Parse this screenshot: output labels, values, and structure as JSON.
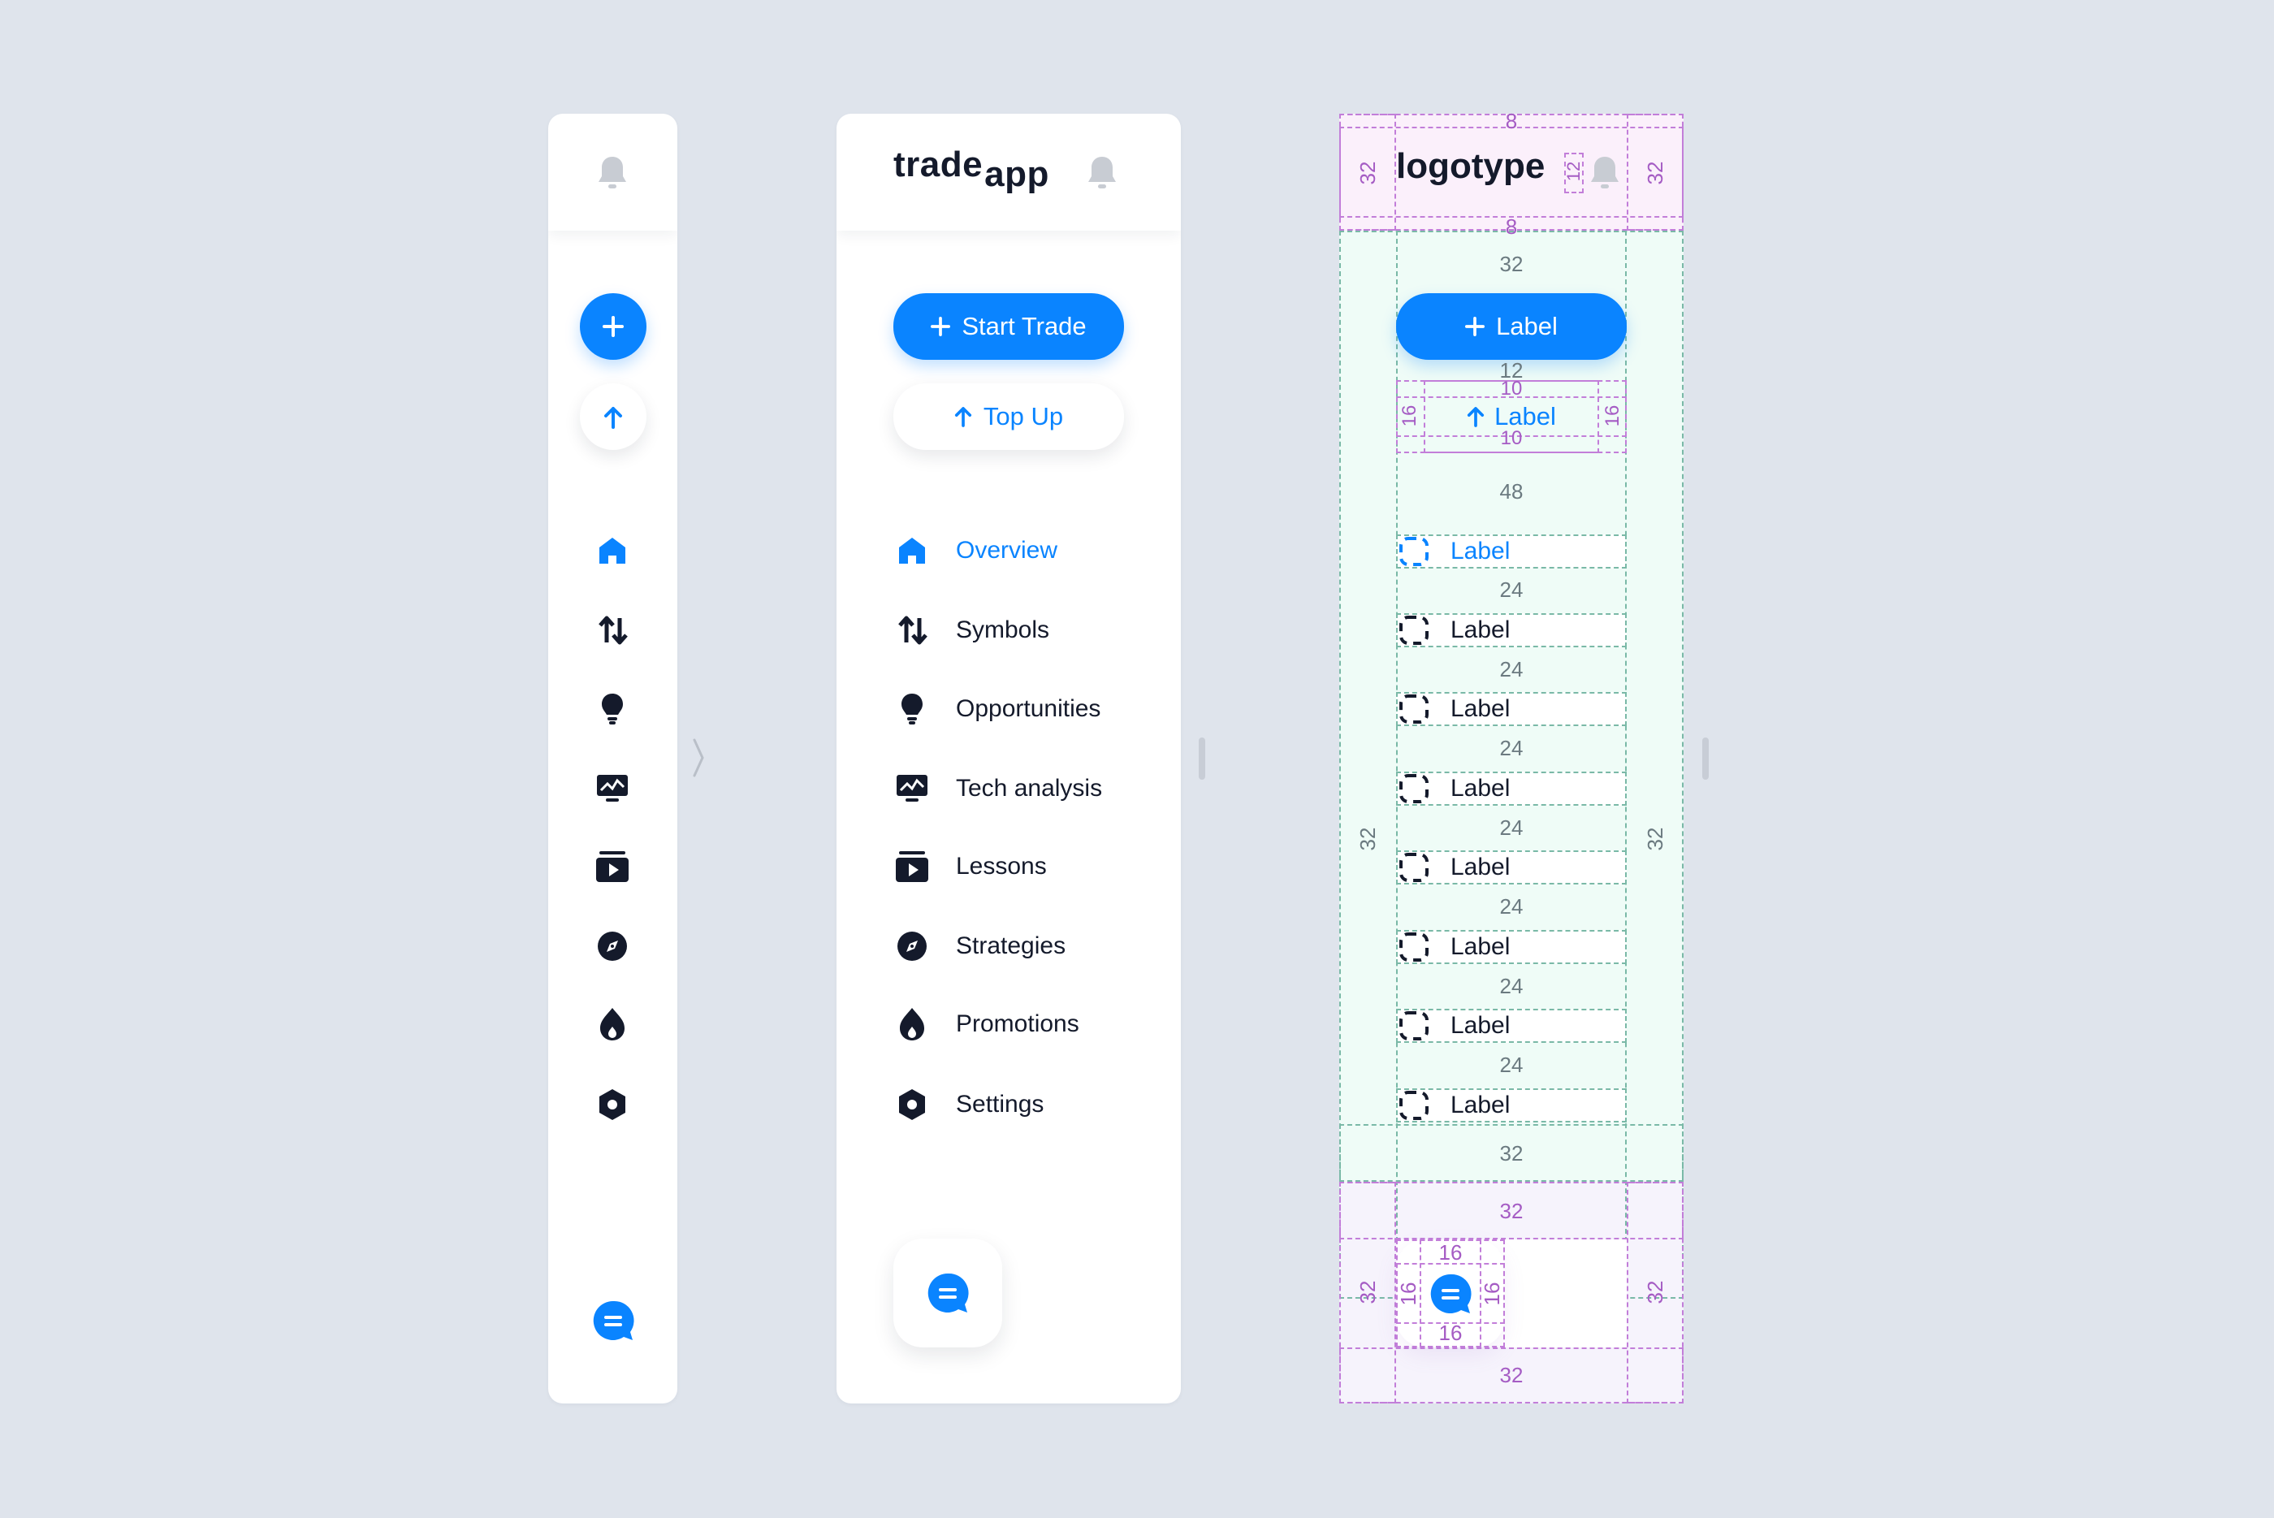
{
  "colors": {
    "background": "#dfe4ec",
    "accent": "#0a84ff",
    "text": "#141a2b",
    "muted_icon": "#c8ccd3",
    "spec_purple": "#c27ed9",
    "spec_teal": "#7ab9a7"
  },
  "collapsed": {
    "header_icon": "bell-icon",
    "primary_icon": "plus-icon",
    "secondary_icon": "arrow-up-icon",
    "nav_icons": [
      "home-icon",
      "arrows-up-down-icon",
      "lightbulb-icon",
      "chart-monitor-icon",
      "play-card-icon",
      "compass-icon",
      "flame-icon",
      "hexagon-settings-icon"
    ],
    "chat_icon": "chat-bubble-icon"
  },
  "expanded": {
    "logo_part1": "trade",
    "logo_part2": "app",
    "primary_button": "Start Trade",
    "secondary_button": "Top Up",
    "nav": [
      {
        "label": "Overview",
        "icon": "home-icon",
        "active": true
      },
      {
        "label": "Symbols",
        "icon": "arrows-up-down-icon"
      },
      {
        "label": "Opportunities",
        "icon": "lightbulb-icon"
      },
      {
        "label": "Tech analysis",
        "icon": "chart-monitor-icon"
      },
      {
        "label": "Lessons",
        "icon": "play-card-icon"
      },
      {
        "label": "Strategies",
        "icon": "compass-icon"
      },
      {
        "label": "Promotions",
        "icon": "flame-icon"
      },
      {
        "label": "Settings",
        "icon": "hexagon-settings-icon"
      }
    ]
  },
  "spec": {
    "logotype": "logotype",
    "button_label": "Label",
    "item_label": "Label",
    "numbers": {
      "header_pad_top": "8",
      "header_pad_bottom": "8",
      "header_side": "32",
      "bell_gap": "12",
      "content_top": "32",
      "button_gap": "12",
      "secondary_pad_v": "10",
      "secondary_pad_h": "16",
      "nav_gap_top": "48",
      "item_gap": "24",
      "content_side": "32",
      "content_bottom": "32",
      "footer_top": "32",
      "fab_pad": "16",
      "footer_side": "32",
      "footer_bottom": "32"
    }
  }
}
